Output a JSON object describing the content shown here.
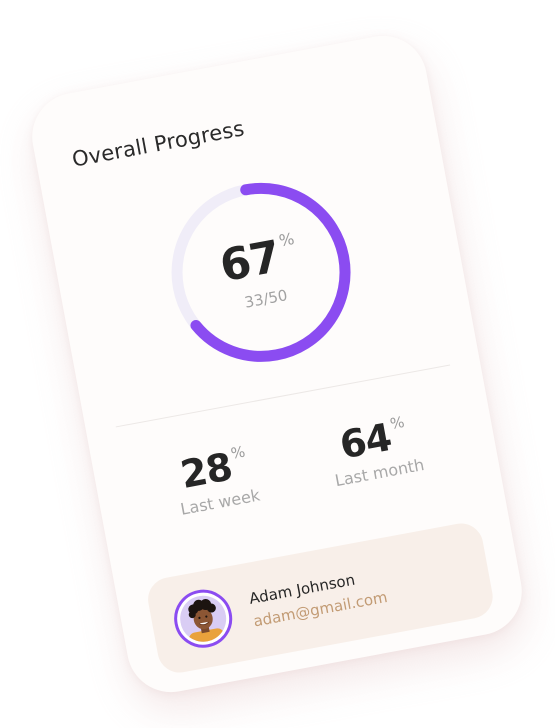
{
  "card": {
    "title": "Overall Progress"
  },
  "overall": {
    "percent": 67,
    "percent_sign": "%",
    "fraction": "33/50",
    "completed": 33,
    "total": 50
  },
  "stats": [
    {
      "value": "28",
      "sign": "%",
      "label": "Last week"
    },
    {
      "value": "64",
      "sign": "%",
      "label": "Last month"
    }
  ],
  "user": {
    "name": "Adam Johnson",
    "email": "adam@gmail.com"
  },
  "colors": {
    "accent": "#8b4cf1",
    "ring_track": "#f0edf8",
    "email": "#c29b74",
    "user_card_bg": "#f8efe9"
  },
  "icons": {
    "avatar": "user-avatar-photo"
  }
}
